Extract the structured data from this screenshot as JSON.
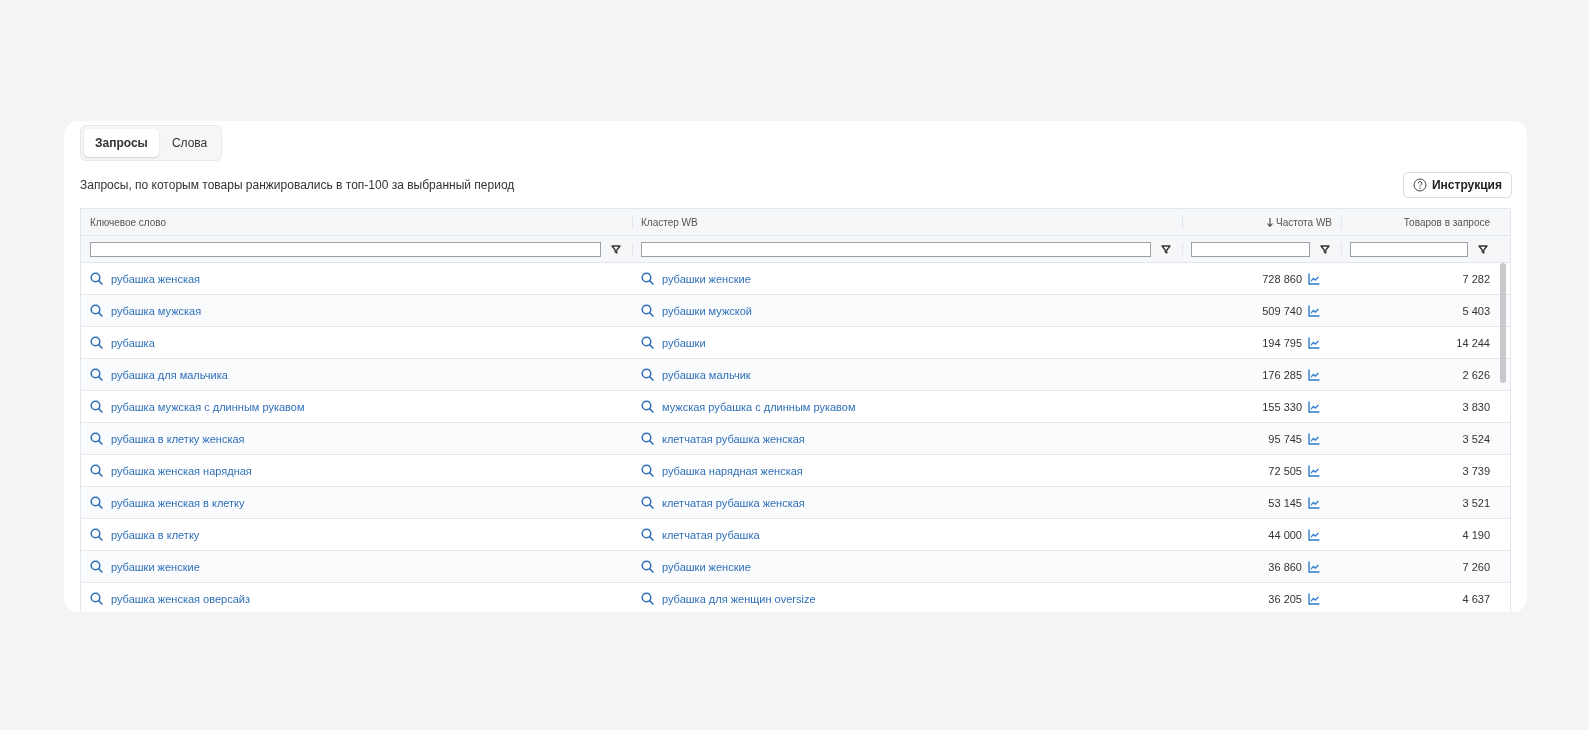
{
  "tabs": [
    {
      "label": "Запросы",
      "selected": true
    },
    {
      "label": "Слова",
      "selected": false
    }
  ],
  "description": "Запросы, по которым товары ранжировались в топ-100 за выбранный период",
  "help_button": {
    "label": "Инструкция"
  },
  "table": {
    "columns": [
      {
        "label": "Ключевое слово",
        "sorted": false
      },
      {
        "label": "Кластер WB",
        "sorted": false
      },
      {
        "label": "Частота WB",
        "sorted": true
      },
      {
        "label": "Товаров в запросе",
        "sorted": false
      }
    ],
    "rows": [
      {
        "keyword": "рубашка женская",
        "cluster": "рубашки женские",
        "frequency": "728 860",
        "products": "7 282"
      },
      {
        "keyword": "рубашка мужская",
        "cluster": "рубашки мужской",
        "frequency": "509 740",
        "products": "5 403"
      },
      {
        "keyword": "рубашка",
        "cluster": "рубашки",
        "frequency": "194 795",
        "products": "14 244"
      },
      {
        "keyword": "рубашка для мальчика",
        "cluster": "рубашка мальчик",
        "frequency": "176 285",
        "products": "2 626"
      },
      {
        "keyword": "рубашка мужская с длинным рукавом",
        "cluster": "мужская рубашка с длинным рукавом",
        "frequency": "155 330",
        "products": "3 830"
      },
      {
        "keyword": "рубашка в клетку женская",
        "cluster": "клетчатая рубашка женская",
        "frequency": "95 745",
        "products": "3 524"
      },
      {
        "keyword": "рубашка женская нарядная",
        "cluster": "рубашка нарядная женская",
        "frequency": "72 505",
        "products": "3 739"
      },
      {
        "keyword": "рубашка женская в клетку",
        "cluster": "клетчатая рубашка женская",
        "frequency": "53 145",
        "products": "3 521"
      },
      {
        "keyword": "рубашка в клетку",
        "cluster": "клетчатая рубашка",
        "frequency": "44 000",
        "products": "4 190"
      },
      {
        "keyword": "рубашки женские",
        "cluster": "рубашки женские",
        "frequency": "36 860",
        "products": "7 260"
      },
      {
        "keyword": "рубашка женская оверсайз",
        "cluster": "рубашка для женщин oversize",
        "frequency": "36 205",
        "products": "4 637"
      }
    ]
  }
}
